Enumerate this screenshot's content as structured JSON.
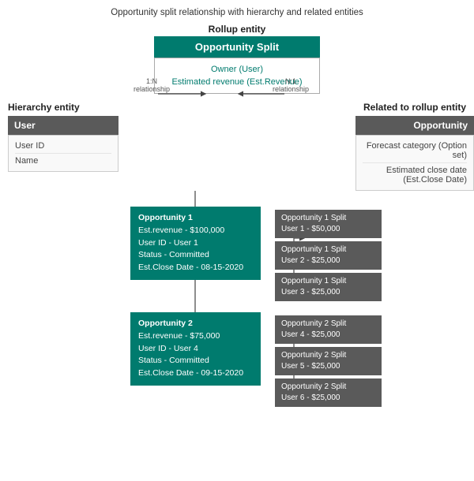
{
  "page": {
    "title": "Opportunity split relationship with hierarchy and related entities"
  },
  "rollup": {
    "section_label": "Rollup entity",
    "box_label": "Opportunity Split",
    "fields": [
      "Owner (User)",
      "Estimated revenue (Est.Revenue)"
    ]
  },
  "hierarchy": {
    "section_label": "Hierarchy entity",
    "header": "User",
    "fields": [
      "User ID",
      "Name"
    ]
  },
  "related": {
    "section_label": "Related to rollup entity",
    "header": "Opportunity",
    "fields": [
      "Forecast category (Option set)",
      "Estimated close date (Est.Close Date)"
    ]
  },
  "relationships": {
    "left": "1:N\nrelationship",
    "right": "N:1\nrelationship"
  },
  "opportunities": [
    {
      "lines": [
        "Opportunity 1",
        "Est.revenue - $100,000",
        "User ID - User 1",
        "Status - Committed",
        "Est.Close Date - 08-15-2020"
      ],
      "splits": [
        "Opportunity 1 Split\nUser 1 - $50,000",
        "Opportunity 1 Split\nUser 2 - $25,000",
        "Opportunity 1 Split\nUser 3 - $25,000"
      ]
    },
    {
      "lines": [
        "Opportunity 2",
        "Est.revenue - $75,000",
        "User ID - User 4",
        "Status - Committed",
        "Est.Close Date - 09-15-2020"
      ],
      "splits": [
        "Opportunity 2 Split\nUser 4 - $25,000",
        "Opportunity 2 Split\nUser 5 - $25,000",
        "Opportunity 2 Split\nUser 6 - $25,000"
      ]
    }
  ]
}
